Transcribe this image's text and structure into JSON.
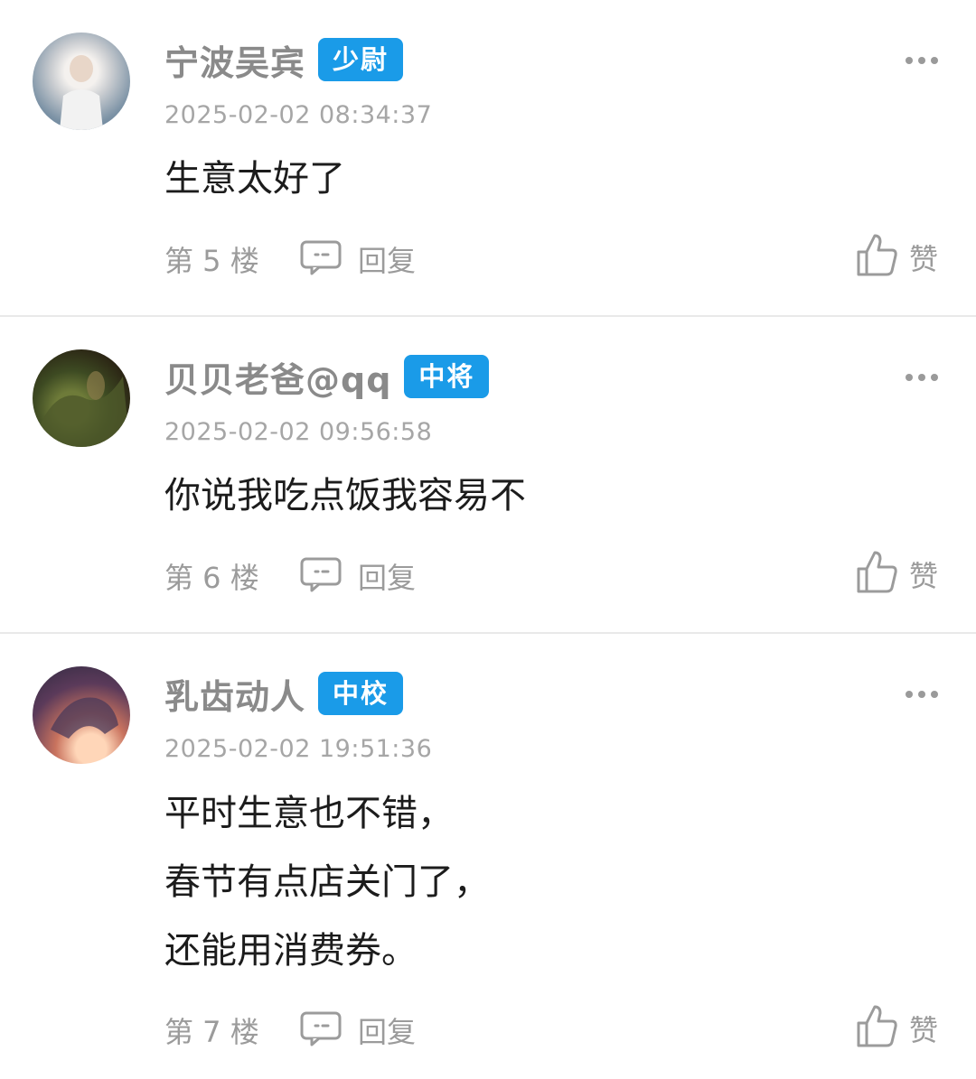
{
  "comments": [
    {
      "username": "宁波吴宾",
      "rank": "少尉",
      "time": "2025-02-02 08:34:37",
      "lines": [
        "生意太好了"
      ],
      "floor": "第 5 楼",
      "reply": "回复",
      "like": "赞"
    },
    {
      "username": "贝贝老爸@qq",
      "rank": "中将",
      "time": "2025-02-02 09:56:58",
      "lines": [
        "你说我吃点饭我容易不"
      ],
      "floor": "第 6 楼",
      "reply": "回复",
      "like": "赞"
    },
    {
      "username": "乳齿动人",
      "rank": "中校",
      "time": "2025-02-02 19:51:36",
      "lines": [
        "平时生意也不错，",
        "春节有点店关门了，",
        "还能用消费券。"
      ],
      "floor": "第 7 楼",
      "reply": "回复",
      "like": "赞"
    }
  ],
  "colors": {
    "badge": "#1a9be8",
    "meta_text": "#9b9b9b",
    "username": "#8a8a8a",
    "divider": "#e9e9e9"
  },
  "icons": {
    "reply": "comment-bubble-icon",
    "like": "thumbs-up-icon",
    "more": "more-dots-icon"
  }
}
